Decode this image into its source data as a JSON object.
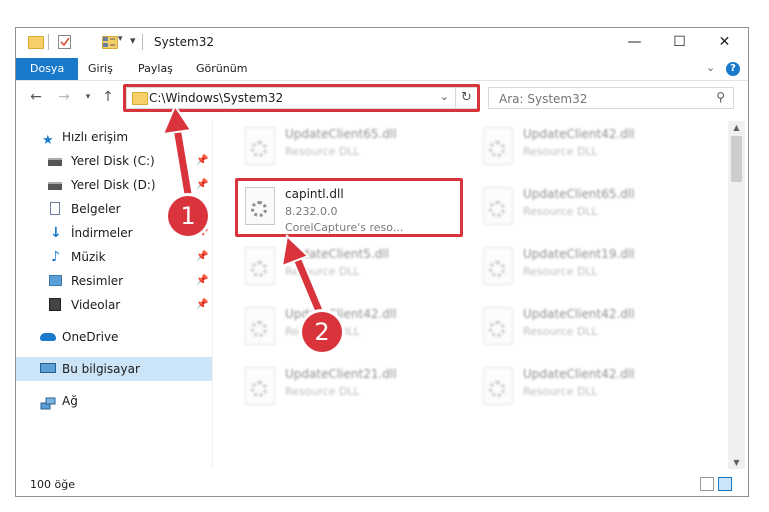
{
  "window": {
    "title": "System32",
    "controls": {
      "minimize": "—",
      "maximize": "☐",
      "close": "✕"
    }
  },
  "ribbon": {
    "tabs": [
      "Dosya",
      "Giriş",
      "Paylaş",
      "Görünüm"
    ]
  },
  "address": {
    "path": "C:\\Windows\\System32",
    "search_placeholder": "Ara: System32"
  },
  "nav": {
    "items": [
      {
        "label": "Hızlı erişim",
        "icon": "star-icon",
        "pinned": false
      },
      {
        "label": "Yerel Disk (C:)",
        "icon": "drive-icon",
        "pinned": true
      },
      {
        "label": "Yerel Disk (D:)",
        "icon": "drive-icon",
        "pinned": true
      },
      {
        "label": "Belgeler",
        "icon": "documents-icon",
        "pinned": true
      },
      {
        "label": "İndirmeler",
        "icon": "download-icon",
        "pinned": true
      },
      {
        "label": "Müzik",
        "icon": "music-icon",
        "pinned": true
      },
      {
        "label": "Resimler",
        "icon": "pictures-icon",
        "pinned": true
      },
      {
        "label": "Videolar",
        "icon": "video-icon",
        "pinned": true
      },
      {
        "label": "OneDrive",
        "icon": "cloud-icon",
        "pinned": false
      },
      {
        "label": "Bu bilgisayar",
        "icon": "computer-icon",
        "pinned": false,
        "selected": true
      },
      {
        "label": "Ağ",
        "icon": "network-icon",
        "pinned": false
      }
    ]
  },
  "files": {
    "left_column": [
      {
        "name": "UpdateClient65.dll",
        "type": "Resource DLL"
      },
      {
        "name": "capintl.dll",
        "version": "8.232.0.0",
        "description": "CorelCapture's reso...",
        "highlighted": true
      },
      {
        "name": "UpdateClient5.dll",
        "type": "Resource DLL"
      },
      {
        "name": "UpdateClient42.dll",
        "type": "Resource DLL"
      },
      {
        "name": "UpdateClient21.dll",
        "type": "Resource DLL"
      }
    ],
    "right_column": [
      {
        "name": "UpdateClient42.dll",
        "type": "Resource DLL"
      },
      {
        "name": "UpdateClient65.dll",
        "type": "Resource DLL"
      },
      {
        "name": "UpdateClient19.dll",
        "type": "Resource DLL"
      },
      {
        "name": "UpdateClient42.dll",
        "type": "Resource DLL"
      },
      {
        "name": "UpdateClient42.dll",
        "type": "Resource DLL"
      }
    ]
  },
  "status": {
    "count": "100 öğe"
  },
  "annotations": {
    "step1": "1",
    "step2": "2"
  },
  "colors": {
    "accent": "#1979ca",
    "highlight": "#d9343c",
    "selected": "#cce4f7"
  }
}
